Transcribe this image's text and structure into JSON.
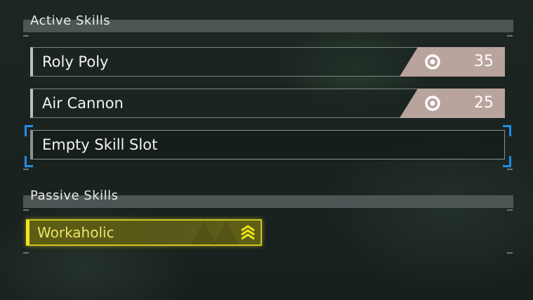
{
  "active_skills": {
    "title": "Active Skills",
    "skills": [
      {
        "name": "Roly Poly",
        "power": "35"
      },
      {
        "name": "Air Cannon",
        "power": "25"
      }
    ],
    "empty_slot_label": "Empty Skill Slot"
  },
  "passive_skills": {
    "title": "Passive Skills",
    "skills": [
      {
        "name": "Workaholic",
        "rank_icon": "chevron-rank-up-icon"
      }
    ]
  },
  "colors": {
    "accent_selection": "#1e8ee6",
    "passive_highlight": "#f0e51e",
    "power_badge": "#b9a39d"
  }
}
